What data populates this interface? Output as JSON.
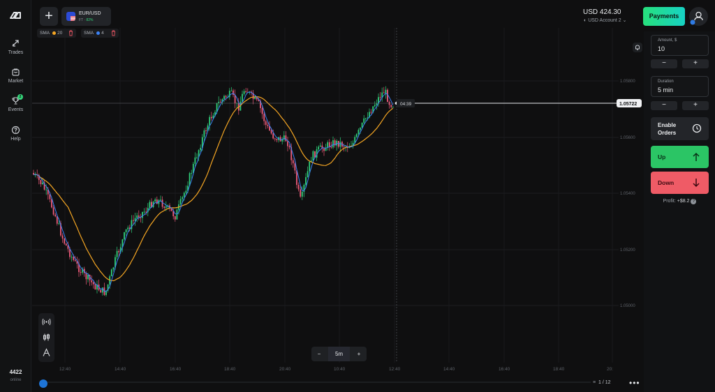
{
  "sidebar": {
    "items": [
      {
        "label": "Trades",
        "icon": "trades-icon"
      },
      {
        "label": "Market",
        "icon": "market-icon"
      },
      {
        "label": "Events",
        "icon": "trophy-icon",
        "badge": "2"
      },
      {
        "label": "Help",
        "icon": "help-icon"
      }
    ],
    "online_count": "4422",
    "online_label": "online"
  },
  "asset": {
    "name": "EUR/USD",
    "type": "FT",
    "payout": "82%"
  },
  "indicators": [
    {
      "name": "SMA",
      "period": "20",
      "color": "#f5a623"
    },
    {
      "name": "SMA",
      "period": "4",
      "color": "#3b82f6"
    }
  ],
  "chart": {
    "current_price": "1.05722",
    "timer": "04:39",
    "price_ticks": [
      "1.05800",
      "1.05600",
      "1.05400",
      "1.05200",
      "1.05000"
    ],
    "time_ticks": [
      "12:40",
      "14:40",
      "16:40",
      "18:40",
      "20:40",
      "10:40",
      "12:40",
      "14:40",
      "16:40",
      "18:40",
      "20:"
    ],
    "timeframe": "5m",
    "page": "1 / 12",
    "colors": {
      "up": "#2fd07a",
      "down": "#ef5b7a",
      "sma20": "#f5a623",
      "sma4": "#3b82f6"
    }
  },
  "header": {
    "balance": "USD 424.30",
    "account": "USD Account 2",
    "payments_label": "Payments"
  },
  "trade": {
    "amount_label": "Amount, $",
    "amount_value": "10",
    "duration_label": "Duration",
    "duration_value": "5 min",
    "enable_orders_label": "Enable Orders",
    "up_label": "Up",
    "down_label": "Down",
    "profit_label": "Profit:",
    "profit_value": "+$8.2"
  }
}
